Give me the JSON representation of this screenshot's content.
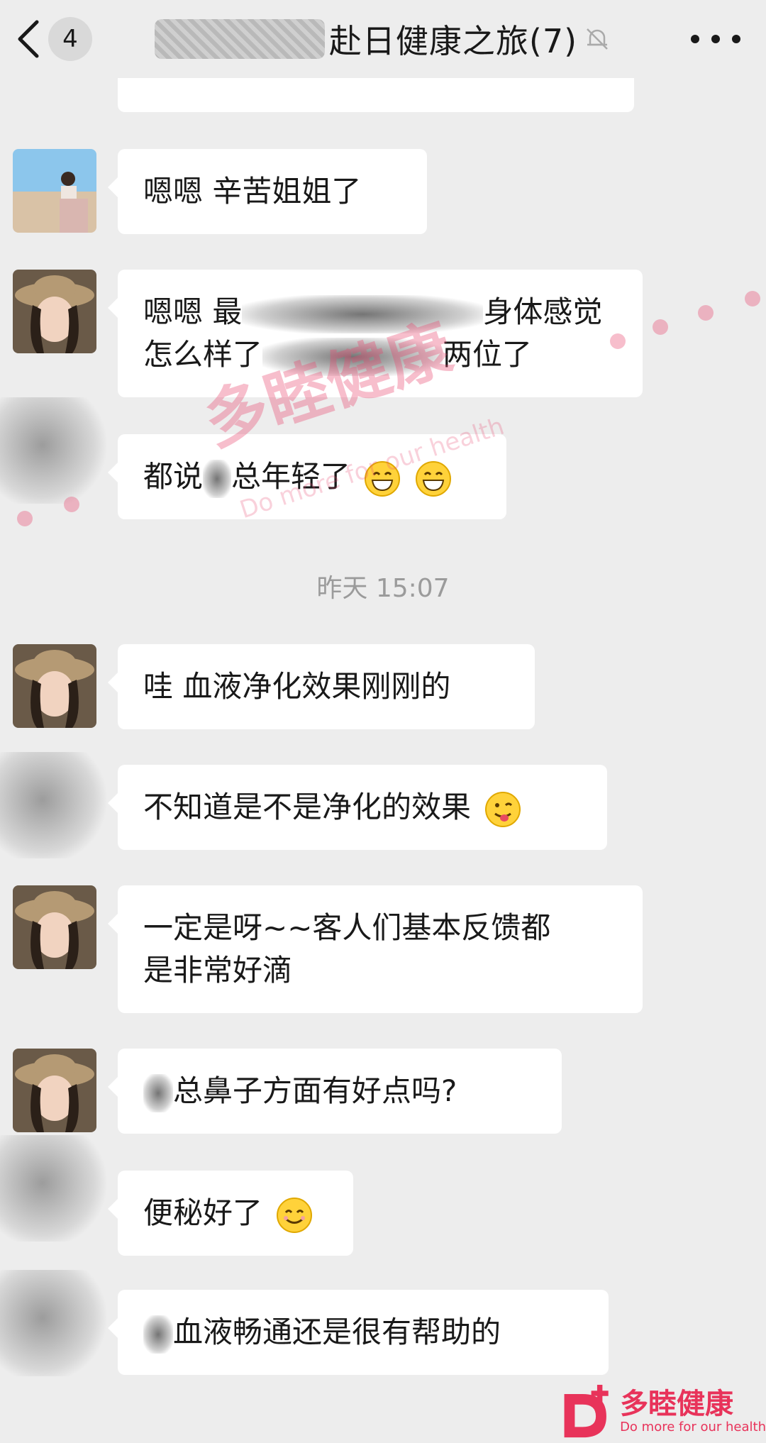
{
  "header": {
    "unread_count": "4",
    "title": "赴日健康之旅(7)",
    "back_icon": "chevron-left-icon",
    "mute_icon": "bell-mute-icon",
    "more_icon": "ellipsis-icon"
  },
  "messages": [
    {
      "text": "嗯嗯 辛苦姐姐了"
    },
    {
      "line1_a": "嗯嗯 最",
      "line1_b": "身体感觉",
      "line2_a": "怎么样了",
      "line2_b": "两位了"
    },
    {
      "text_a": "都说",
      "text_b": "总年轻了"
    },
    {
      "text": "哇 血液净化效果刚刚的"
    },
    {
      "text": "不知道是不是净化的效果"
    },
    {
      "line1": "一定是呀~~客人们基本反馈都",
      "line2": "是非常好滴"
    },
    {
      "text": "总鼻子方面有好点吗?"
    },
    {
      "text": "便秘好了"
    },
    {
      "text": "血液畅通还是很有帮助的"
    }
  ],
  "timestamp": "昨天 15:07",
  "watermark": {
    "main": "多睦健康",
    "sub": "Do more for our health"
  },
  "brand": {
    "name": "多睦健康",
    "slogan": "Do more for our health",
    "color": "#e8335a"
  }
}
